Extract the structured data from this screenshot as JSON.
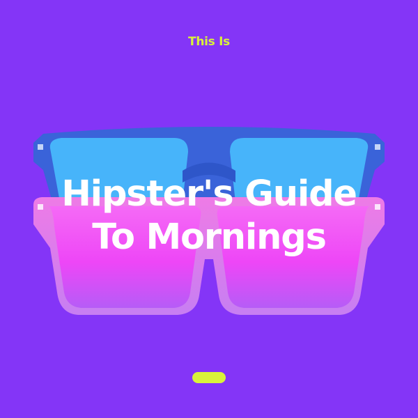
{
  "cover": {
    "kicker": "This Is",
    "title_line1": "Hipster's Guide",
    "title_line2": "To Mornings",
    "accent_color": "#d9f23a",
    "background_color": "#8435f7",
    "artwork": "sunglasses-image"
  }
}
